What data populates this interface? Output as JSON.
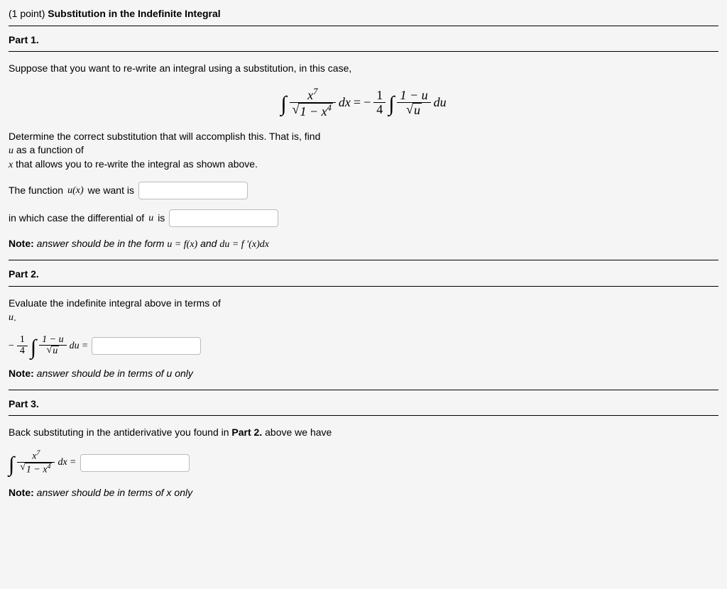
{
  "header": {
    "points": "(1 point)",
    "title": "Substitution in the Indefinite Integral"
  },
  "part1": {
    "label": "Part 1.",
    "intro": "Suppose that you want to re-write an integral using a substitution, in this case,",
    "eq_lhs_num": "x",
    "eq_lhs_num_sup": "7",
    "eq_lhs_den_inner": "1 − x",
    "eq_lhs_den_sup": "4",
    "eq_dx": "dx",
    "eq_eq": "=",
    "eq_minus": "−",
    "eq_frac_num": "1",
    "eq_frac_den": "4",
    "eq_rhs_num": "1 − u",
    "eq_rhs_den": "u",
    "eq_du": "du",
    "after1": "Determine the correct substitution that will accomplish this. That is, find",
    "after2": "u",
    "after3": " as a function of",
    "after4": "x",
    "after5": " that allows you to re-write the integral as shown above.",
    "q1_pre": "The function ",
    "q1_ux": "u(x)",
    "q1_post": " we want is",
    "q2_pre": "in which case the differential of ",
    "q2_u": "u",
    "q2_post": " is",
    "note_label": "Note:",
    "note_text": " answer should be in the form ",
    "note_form1": "u = f(x)",
    "note_and": " and ",
    "note_form2": "du = f ′(x)dx"
  },
  "part2": {
    "label": "Part 2.",
    "intro1": "Evaluate the indefinite integral above in terms of",
    "intro2": "u",
    "intro3": ".",
    "eq_minus": "−",
    "eq_frac_num": "1",
    "eq_frac_den": "4",
    "eq_num": "1 − u",
    "eq_den": "u",
    "eq_du": "du",
    "eq_eq": "=",
    "note_label": "Note:",
    "note_text": " answer should be in terms of u only"
  },
  "part3": {
    "label": "Part 3.",
    "intro_a": "Back substituting in the antiderivative you found in ",
    "intro_b": "Part 2.",
    "intro_c": " above we have",
    "eq_num": "x",
    "eq_num_sup": "7",
    "eq_den_inner": "1 − x",
    "eq_den_sup": "4",
    "eq_dx": "dx",
    "eq_eq": "=",
    "note_label": "Note:",
    "note_text": " answer should be in terms of x only"
  }
}
